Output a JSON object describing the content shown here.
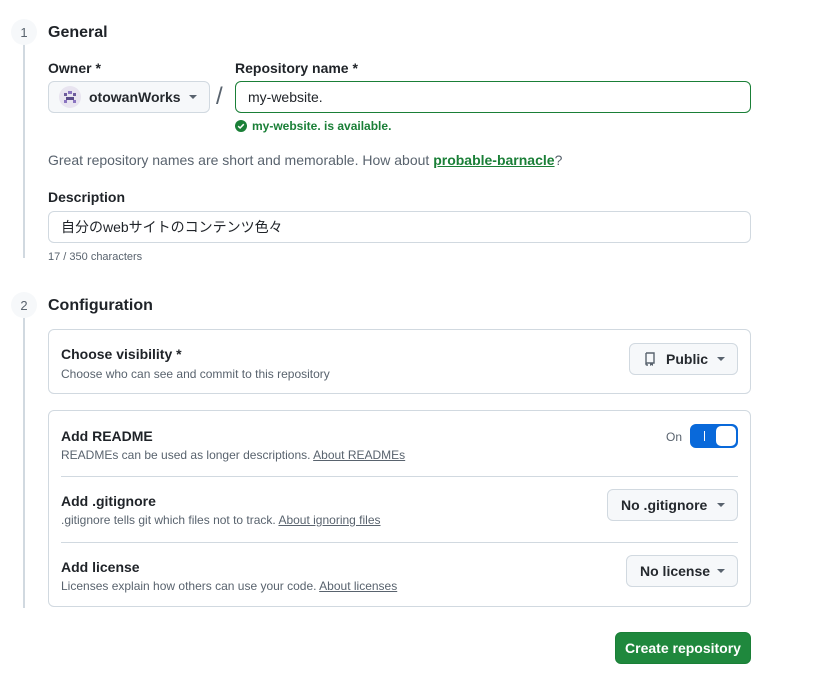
{
  "steps": [
    {
      "number": "1",
      "title": "General"
    },
    {
      "number": "2",
      "title": "Configuration"
    }
  ],
  "owner": {
    "label": "Owner *",
    "value": "otowanWorks"
  },
  "slash": "/",
  "repo_name": {
    "label": "Repository name *",
    "value": "my-website.",
    "availability": "my-website. is available."
  },
  "suggestion": {
    "text": "Great repository names are short and memorable. How about ",
    "name": "probable-barnacle",
    "end": "?"
  },
  "description": {
    "label": "Description",
    "value": "自分のwebサイトのコンテンツ色々",
    "count": "17 / 350 characters"
  },
  "visibility": {
    "title": "Choose visibility *",
    "desc": "Choose who can see and commit to this repository",
    "value": "Public"
  },
  "readme": {
    "title": "Add README",
    "desc": "READMEs can be used as longer descriptions. ",
    "link": "About READMEs",
    "toggle_state": "On",
    "toggle_on": true
  },
  "gitignore": {
    "title": "Add .gitignore",
    "desc": ".gitignore tells git which files not to track. ",
    "link": "About ignoring files",
    "value": "No .gitignore"
  },
  "license": {
    "title": "Add license",
    "desc": "Licenses explain how others can use your code. ",
    "link": "About licenses",
    "value": "No license"
  },
  "submit": {
    "label": "Create repository"
  },
  "colors": {
    "primary_green": "#1f883d",
    "toggle_blue": "#0969da",
    "success_green": "#1a7f37"
  }
}
